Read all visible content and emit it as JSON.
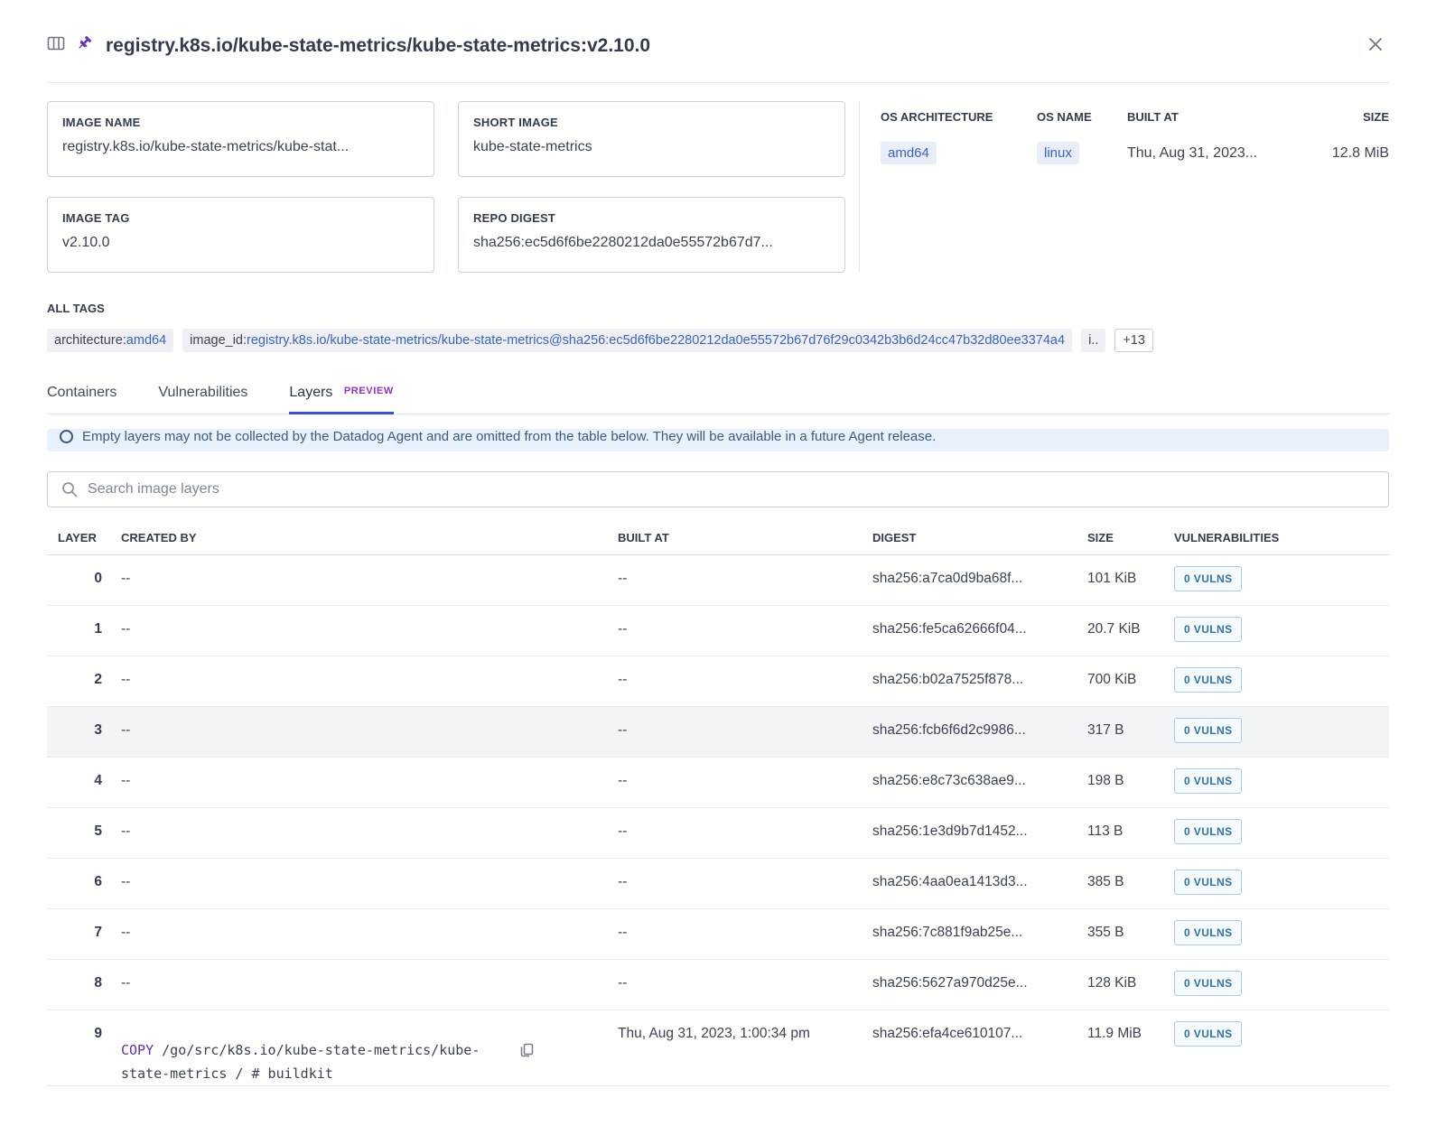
{
  "window": {
    "title": "registry.k8s.io/kube-state-metrics/kube-state-metrics:v2.10.0"
  },
  "summary": {
    "fields": [
      {
        "label": "IMAGE NAME",
        "value": "registry.k8s.io/kube-state-metrics/kube-stat..."
      },
      {
        "label": "SHORT IMAGE",
        "value": "kube-state-metrics"
      },
      {
        "label": "IMAGE TAG",
        "value": "v2.10.0"
      },
      {
        "label": "REPO DIGEST",
        "value": "sha256:ec5d6f6be2280212da0e55572b67d7..."
      }
    ]
  },
  "os_info": {
    "headers": [
      "OS ARCHITECTURE",
      "OS NAME",
      "BUILT AT",
      "SIZE"
    ],
    "architecture": "amd64",
    "os_name": "linux",
    "built_at": "Thu, Aug 31, 2023...",
    "size": "12.8 MiB"
  },
  "all_tags": {
    "label": "ALL TAGS",
    "tags": [
      {
        "key": "architecture:",
        "value": "amd64"
      },
      {
        "key": "image_id:",
        "value": "registry.k8s.io/kube-state-metrics/kube-state-metrics@sha256:ec5d6f6be2280212da0e55572b67d76f29c0342b3b6d24cc47b32d80ee3374a4"
      },
      {
        "key": "i..",
        "value": ""
      }
    ],
    "more": "+13"
  },
  "tabs": [
    {
      "label": "Containers"
    },
    {
      "label": "Vulnerabilities"
    },
    {
      "label": "Layers",
      "badge": "PREVIEW",
      "active": true
    }
  ],
  "banner": {
    "text": "Empty layers may not be collected by the Datadog Agent and are omitted from the table below. They will be available in a future Agent release."
  },
  "search": {
    "placeholder": "Search image layers"
  },
  "layers_table": {
    "headers": [
      "LAYER",
      "CREATED BY",
      "BUILT AT",
      "DIGEST",
      "SIZE",
      "VULNERABILITIES"
    ],
    "rows": [
      {
        "layer": "0",
        "created_by": "--",
        "built_at": "--",
        "digest": "sha256:a7ca0d9ba68f...",
        "size": "101 KiB",
        "vulnerabilities": "0 VULNS"
      },
      {
        "layer": "1",
        "created_by": "--",
        "built_at": "--",
        "digest": "sha256:fe5ca62666f04...",
        "size": "20.7 KiB",
        "vulnerabilities": "0 VULNS"
      },
      {
        "layer": "2",
        "created_by": "--",
        "built_at": "--",
        "digest": "sha256:b02a7525f878...",
        "size": "700 KiB",
        "vulnerabilities": "0 VULNS"
      },
      {
        "layer": "3",
        "created_by": "--",
        "built_at": "--",
        "digest": "sha256:fcb6f6d2c9986...",
        "size": "317 B",
        "vulnerabilities": "0 VULNS",
        "highlighted": true
      },
      {
        "layer": "4",
        "created_by": "--",
        "built_at": "--",
        "digest": "sha256:e8c73c638ae9...",
        "size": "198 B",
        "vulnerabilities": "0 VULNS"
      },
      {
        "layer": "5",
        "created_by": "--",
        "built_at": "--",
        "digest": "sha256:1e3d9b7d1452...",
        "size": "113 B",
        "vulnerabilities": "0 VULNS"
      },
      {
        "layer": "6",
        "created_by": "--",
        "built_at": "--",
        "digest": "sha256:4aa0ea1413d3...",
        "size": "385 B",
        "vulnerabilities": "0 VULNS"
      },
      {
        "layer": "7",
        "created_by": "--",
        "built_at": "--",
        "digest": "sha256:7c881f9ab25e...",
        "size": "355 B",
        "vulnerabilities": "0 VULNS"
      },
      {
        "layer": "8",
        "created_by": "--",
        "built_at": "--",
        "digest": "sha256:5627a970d25e...",
        "size": "128 KiB",
        "vulnerabilities": "0 VULNS"
      },
      {
        "layer": "9",
        "code": {
          "keyword": "COPY ",
          "text": "/go/src/k8s.io/kube-state-metrics/kube-state-metrics / # buildkit"
        },
        "built_at": "Thu, Aug 31, 2023, 1:00:34 pm",
        "digest": "sha256:efa4ce610107...",
        "size": "11.9 MiB",
        "vulnerabilities": "0 VULNS"
      }
    ]
  },
  "colors": {
    "accent_tab_blue": "#3a4de8",
    "preview_purple": "#8f30cc",
    "link_blue": "#3c62c6",
    "vuln_badge_text": "#2d71ad",
    "banner_bg": "#e7f2fc"
  }
}
